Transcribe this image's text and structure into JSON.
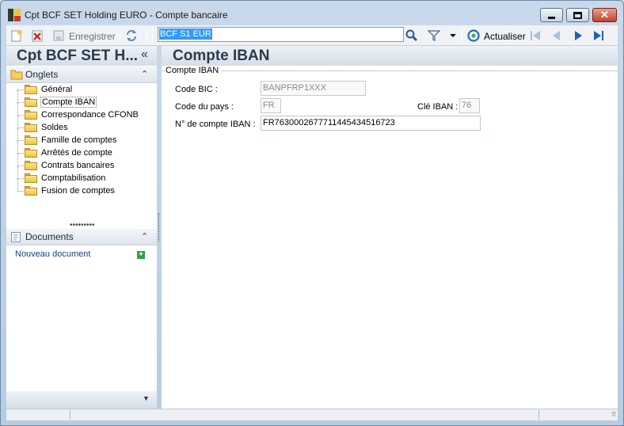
{
  "window": {
    "title": "Cpt BCF SET Holding EURO -  Compte bancaire",
    "minimize_icon": "minimize-icon",
    "maximize_icon": "maximize-icon",
    "close_glyph": "✕"
  },
  "toolbar": {
    "new_icon": "new-document-icon",
    "delete_icon": "delete-icon",
    "save_label": "Enregistrer",
    "refresh_icon": "sync-icon",
    "record_value": "BCF S1 EUR",
    "search_icon": "magnifier-icon",
    "filter_icon": "filter-icon",
    "refresh_label": "Actualiser",
    "nav_icons": [
      "first-record-icon",
      "previous-record-icon",
      "next-record-icon",
      "last-record-icon"
    ]
  },
  "left_panel": {
    "title": "Cpt BCF SET H...",
    "collapse_glyph": "«",
    "tabs_section": {
      "label": "Onglets",
      "collapse_glyph": "⌃",
      "items": [
        {
          "label": "Général"
        },
        {
          "label": "Compte IBAN",
          "selected": true
        },
        {
          "label": "Correspondance CFONB"
        },
        {
          "label": "Soldes"
        },
        {
          "label": "Famille de comptes"
        },
        {
          "label": "Arrêtés de compte"
        },
        {
          "label": "Contrats bancaires"
        },
        {
          "label": "Comptabilisation"
        },
        {
          "label": "Fusion de comptes"
        }
      ]
    },
    "splitter_glyph": "•••••••••",
    "documents_section": {
      "label": "Documents",
      "collapse_glyph": "⌃",
      "new_link": "Nouveau document",
      "add_glyph": "+"
    },
    "footer_glyph": "▼"
  },
  "main": {
    "title": "Compte IBAN",
    "group_title": "Compte IBAN",
    "fields": {
      "bic_label": "Code BIC :",
      "bic_value": "BANPFRP1XXX",
      "country_label": "Code du pays :",
      "country_value": "FR",
      "iban_key_label": "Clé IBAN :",
      "iban_key_value": "76",
      "iban_label": "N° de compte IBAN :",
      "iban_value": "FR7630002677711445434516723"
    }
  },
  "statusbar": {
    "grip_glyph": "⠿"
  },
  "colors": {
    "header_text": "#2b3b4d",
    "selection": "#3399ff",
    "link": "#1a3e8a"
  }
}
